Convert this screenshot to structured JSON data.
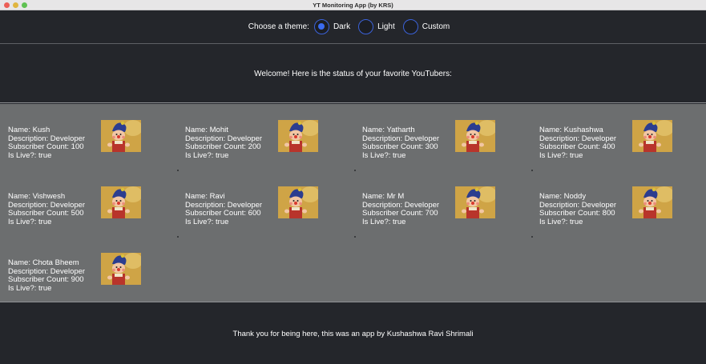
{
  "window": {
    "title": "YT Monitoring App (by KRS)"
  },
  "theme": {
    "label": "Choose a theme:",
    "options": [
      {
        "label": "Dark",
        "checked": true
      },
      {
        "label": "Light",
        "checked": false
      },
      {
        "label": "Custom",
        "checked": false
      }
    ]
  },
  "welcome": "Welcome! Here is the status of your favorite YouTubers:",
  "youtubers": [
    {
      "name": "Name: Kush",
      "description": "Description: Developer",
      "subscribers": "Subscriber Count: 100",
      "live": "Is Live?: true"
    },
    {
      "name": "Name: Mohit",
      "description": "Description: Developer",
      "subscribers": "Subscriber Count: 200",
      "live": "Is Live?: true"
    },
    {
      "name": "Name: Yatharth",
      "description": "Description: Developer",
      "subscribers": "Subscriber Count: 300",
      "live": "Is Live?: true"
    },
    {
      "name": "Name: Kushashwa",
      "description": "Description: Developer",
      "subscribers": "Subscriber Count: 400",
      "live": "Is Live?: true"
    },
    {
      "name": "Name: Vishwesh",
      "description": "Description: Developer",
      "subscribers": "Subscriber Count: 500",
      "live": "Is Live?: true"
    },
    {
      "name": "Name: Ravi",
      "description": "Description: Developer",
      "subscribers": "Subscriber Count: 600",
      "live": "Is Live?: true"
    },
    {
      "name": "Name: Mr M",
      "description": "Description: Developer",
      "subscribers": "Subscriber Count: 700",
      "live": "Is Live?: true"
    },
    {
      "name": "Name: Noddy",
      "description": "Description: Developer",
      "subscribers": "Subscriber Count: 800",
      "live": "Is Live?: true"
    },
    {
      "name": "Name: Chota Bheem",
      "description": "Description: Developer",
      "subscribers": "Subscriber Count: 900",
      "live": "Is Live?: true"
    }
  ],
  "footer": "Thank you for being here, this was an app by Kushashwa Ravi Shrimali"
}
